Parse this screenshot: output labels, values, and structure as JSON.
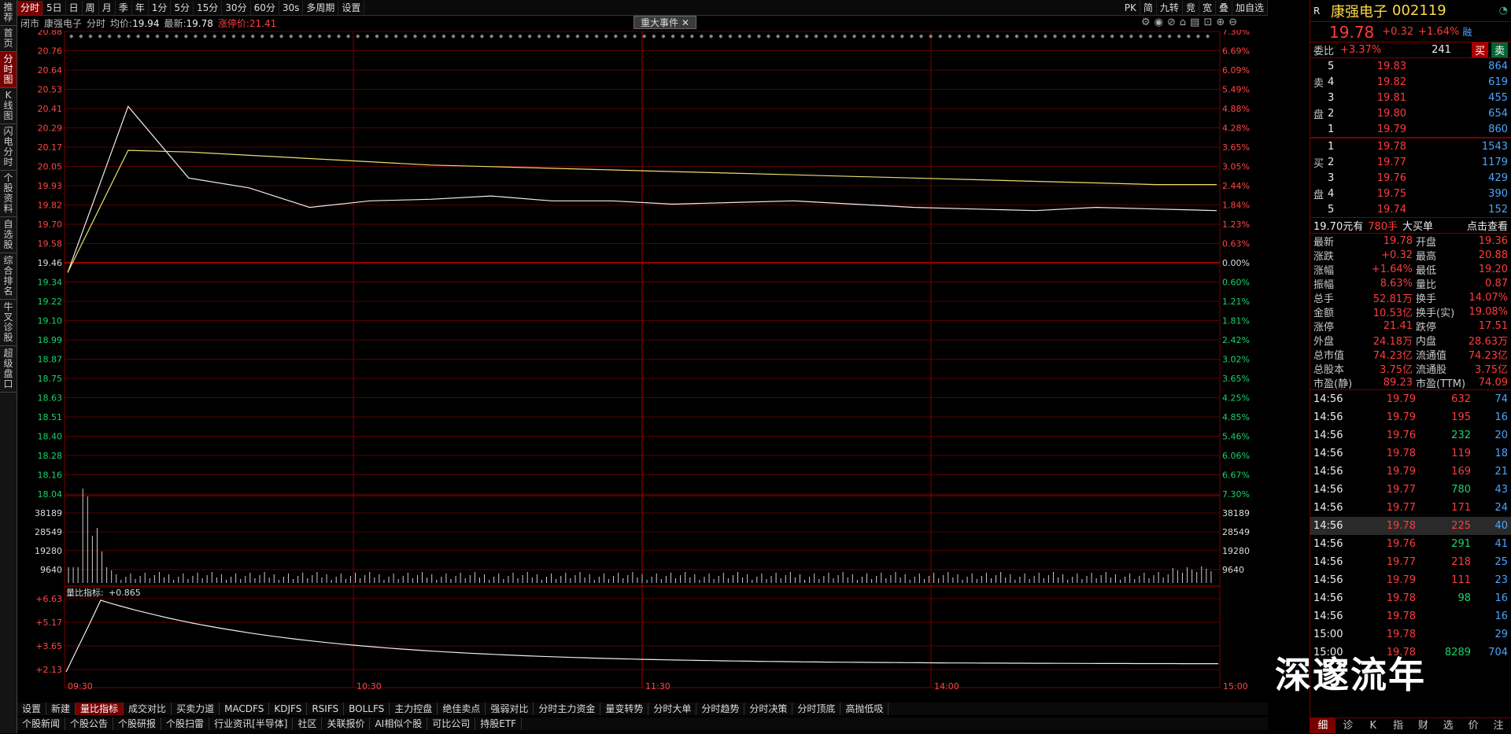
{
  "left_tabs": [
    "推荐",
    "首页",
    "分时图",
    "K线图",
    "闪电分时",
    "个股资料",
    "自选股",
    "综合排名",
    "牛叉诊股",
    "超级盘口"
  ],
  "toolbar": {
    "buttons": [
      "分时",
      "5日",
      "日",
      "周",
      "月",
      "季",
      "年",
      "1分",
      "5分",
      "15分",
      "30分",
      "60分",
      "30s",
      "多周期",
      "设置"
    ],
    "right": [
      "PK",
      "简",
      "九转",
      "竞",
      "宽",
      "叠",
      "加自选"
    ]
  },
  "info": {
    "status": "闭市",
    "name": "康强电子",
    "mode": "分时",
    "avg_label": "均价:",
    "avg": "19.94",
    "last_label": "最新:",
    "last": "19.78",
    "limit_label": "涨停价:",
    "limit": "21.41"
  },
  "event_label": "重大事件",
  "price_axis": {
    "left": [
      "20.88",
      "20.76",
      "20.64",
      "20.53",
      "20.41",
      "20.29",
      "20.17",
      "20.05",
      "19.93",
      "19.82",
      "19.70",
      "19.58",
      "19.46",
      "19.34",
      "19.22",
      "19.10",
      "18.99",
      "18.87",
      "18.75",
      "18.63",
      "18.51",
      "18.40",
      "18.28",
      "18.16",
      "18.04"
    ],
    "right": [
      "7.30%",
      "6.69%",
      "6.09%",
      "5.49%",
      "4.88%",
      "4.28%",
      "3.65%",
      "3.05%",
      "2.44%",
      "1.84%",
      "1.23%",
      "0.63%",
      "0.00%",
      "0.60%",
      "1.21%",
      "1.81%",
      "2.42%",
      "3.02%",
      "3.65%",
      "4.25%",
      "4.85%",
      "5.46%",
      "6.06%",
      "6.67%",
      "7.30%"
    ]
  },
  "volume_axis": {
    "left": [
      "38189",
      "28549",
      "19280",
      "9640"
    ],
    "right": [
      "38189",
      "28549",
      "19280",
      "9640"
    ]
  },
  "ratio": {
    "label": "量比指标:",
    "value": "+0.865",
    "axis": [
      "+6.63",
      "+5.17",
      "+3.65",
      "+2.13"
    ]
  },
  "time_axis": [
    "09:30",
    "10:30",
    "11:30",
    "14:00",
    "15:00"
  ],
  "chart_data": {
    "type": "line",
    "title": "",
    "x": [
      "09:30",
      "09:35",
      "09:40",
      "09:45",
      "09:50",
      "10:00",
      "10:15",
      "10:30",
      "10:45",
      "11:00",
      "11:15",
      "11:30",
      "13:15",
      "13:30",
      "13:45",
      "14:00",
      "14:15",
      "14:30",
      "14:45",
      "15:00"
    ],
    "series": [
      {
        "values": [
          19.4,
          20.42,
          19.98,
          19.92,
          19.8,
          19.84,
          19.85,
          19.87,
          19.84,
          19.84,
          19.82,
          19.83,
          19.84,
          19.82,
          19.8,
          19.79,
          19.78,
          19.8,
          19.79,
          19.78
        ]
      },
      {
        "values": [
          19.4,
          20.15,
          20.14,
          20.12,
          20.1,
          20.08,
          20.06,
          20.05,
          20.04,
          20.03,
          20.02,
          20.01,
          20.0,
          19.99,
          19.98,
          19.97,
          19.96,
          19.95,
          19.94,
          19.94
        ]
      }
    ],
    "ylim": [
      18.04,
      20.88
    ]
  },
  "bottom_tabs": [
    "设置",
    "新建",
    "量比指标",
    "成交对比",
    "买卖力道",
    "MACDFS",
    "KDJFS",
    "RSIFS",
    "BOLLFS",
    "主力控盘",
    "绝佳卖点",
    "强弱对比",
    "分时主力资金",
    "量变转势",
    "分时大单",
    "分时趋势",
    "分时决策",
    "分时顶底",
    "高抛低吸"
  ],
  "news_tabs": [
    "个股新闻",
    "个股公告",
    "个股研报",
    "个股扫雷",
    "行业资讯[半导体]",
    "社区",
    "关联报价",
    "AI相似个股",
    "可比公司",
    "持股ETF"
  ],
  "quote": {
    "name": "康强电子",
    "code": "002119",
    "price": "19.78",
    "change": "+0.32",
    "pct": "+1.64%",
    "tag": "融",
    "wb_label": "委比",
    "wb": "+3.37%",
    "wc": "241",
    "buy": "买",
    "sell": "卖",
    "asks": [
      [
        "5",
        "19.83",
        "864"
      ],
      [
        "4",
        "19.82",
        "619"
      ],
      [
        "3",
        "19.81",
        "455"
      ],
      [
        "2",
        "19.80",
        "654"
      ],
      [
        "1",
        "19.79",
        "860"
      ]
    ],
    "bids": [
      [
        "1",
        "19.78",
        "1543"
      ],
      [
        "2",
        "19.77",
        "1179"
      ],
      [
        "3",
        "19.76",
        "429"
      ],
      [
        "4",
        "19.75",
        "390"
      ],
      [
        "5",
        "19.74",
        "152"
      ]
    ],
    "ask_side": "卖盘",
    "bid_side": "买盘",
    "big_price": "19.70元有",
    "big_vol": "780手",
    "big_label": "大买单",
    "big_link": "点击查看",
    "stats": [
      [
        "最新",
        "19.78",
        "开盘",
        "19.36"
      ],
      [
        "涨跌",
        "+0.32",
        "最高",
        "20.88"
      ],
      [
        "涨幅",
        "+1.64%",
        "最低",
        "19.20"
      ],
      [
        "振幅",
        "8.63%",
        "量比",
        "0.87"
      ],
      [
        "总手",
        "52.81万",
        "换手",
        "14.07%"
      ],
      [
        "金额",
        "10.53亿",
        "换手(实)",
        "19.08%"
      ],
      [
        "涨停",
        "21.41",
        "跌停",
        "17.51"
      ],
      [
        "外盘",
        "24.18万",
        "内盘",
        "28.63万"
      ],
      [
        "总市值",
        "74.23亿",
        "流通值",
        "74.23亿"
      ],
      [
        "总股本",
        "3.75亿",
        "流通股",
        "3.75亿"
      ],
      [
        "市盈(静)",
        "89.23",
        "市盈(TTM)",
        "74.09"
      ]
    ],
    "ticks": [
      [
        "14:56",
        "19.79",
        "632",
        "74"
      ],
      [
        "14:56",
        "19.79",
        "195",
        "16"
      ],
      [
        "14:56",
        "19.76",
        "232",
        "20"
      ],
      [
        "14:56",
        "19.78",
        "119",
        "18"
      ],
      [
        "14:56",
        "19.79",
        "169",
        "21"
      ],
      [
        "14:56",
        "19.77",
        "780",
        "43"
      ],
      [
        "14:56",
        "19.77",
        "171",
        "24"
      ],
      [
        "14:56",
        "19.78",
        "225",
        "40"
      ],
      [
        "14:56",
        "19.76",
        "291",
        "41"
      ],
      [
        "14:56",
        "19.77",
        "218",
        "25"
      ],
      [
        "14:56",
        "19.79",
        "111",
        "23"
      ],
      [
        "14:56",
        "19.78",
        "98",
        "16"
      ],
      [
        "14:56",
        "19.78",
        "",
        "16"
      ],
      [
        "15:00",
        "19.78",
        "",
        "29"
      ],
      [
        "15:00",
        "19.78",
        "8289",
        "704"
      ]
    ],
    "bottom": [
      "细",
      "诊",
      "K",
      "指",
      "财",
      "选",
      "价",
      "注"
    ]
  },
  "watermark": "深邃流年"
}
